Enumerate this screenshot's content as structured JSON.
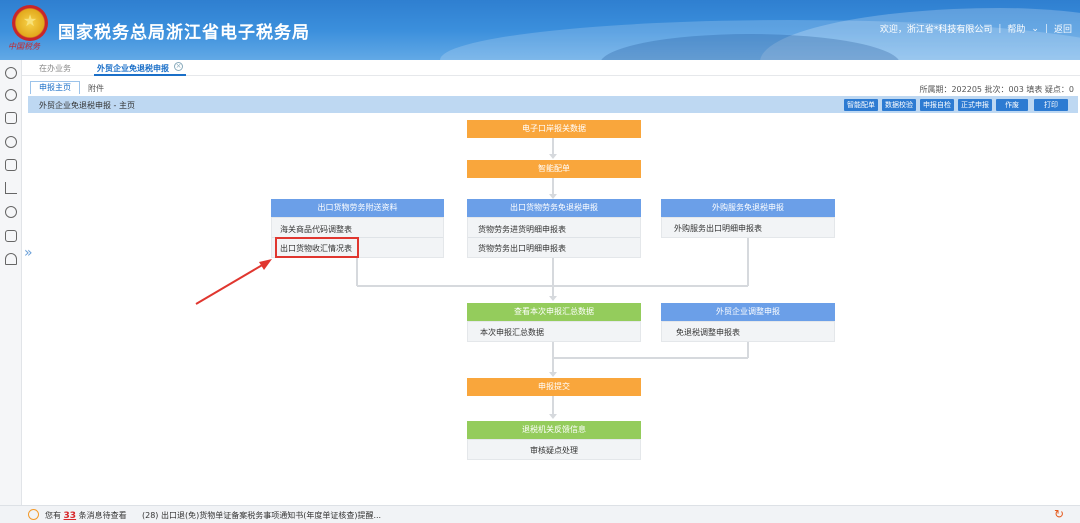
{
  "header": {
    "site_title": "国家税务总局浙江省电子税务局",
    "emblem_sig": "中国税务",
    "welcome": "欢迎，浙江省*科技有限公司",
    "help": "帮助",
    "back": "返回"
  },
  "tabs": {
    "inprogress": "在办业务",
    "export": "外贸企业免退税申报"
  },
  "subtabs": {
    "main": "申报主页",
    "attach": "附件",
    "period_info": "所属期：202205  批次：003  填表  疑点：0"
  },
  "page_bar": {
    "title": "外贸企业免退税申报 - 主页",
    "buttons": [
      "智能配单",
      "数据校验",
      "申报自检",
      "正式申报",
      "作废",
      "打印"
    ]
  },
  "flow": {
    "step_customs": "电子口岸报关数据",
    "step_match": "智能配单",
    "export_attach": {
      "title": "出口货物劳务附送资料",
      "items": [
        "海关商品代码调整表",
        "出口货物收汇情况表"
      ]
    },
    "export_refund": {
      "title": "出口货物劳务免退税申报",
      "items": [
        "货物劳务进货明细申报表",
        "货物劳务出口明细申报表"
      ]
    },
    "service_refund": {
      "title": "外购服务免退税申报",
      "items": [
        "外购服务出口明细申报表"
      ]
    },
    "summary": {
      "title": "查看本次申报汇总数据",
      "items": [
        "本次申报汇总数据"
      ]
    },
    "adjust": {
      "title": "外贸企业调整申报",
      "items": [
        "免退税调整申报表"
      ]
    },
    "submit": "申报提交",
    "feedback": {
      "title": "退税机关反馈信息",
      "items": [
        "审核疑点处理"
      ]
    }
  },
  "footer": {
    "prefix": "您有",
    "count": "33",
    "suffix": "条消息待查看",
    "news": "(28)  出口退(免)货物单证备案税务事项通知书(年度单证核查)提醒..."
  },
  "colors": {
    "orange": "#f9a63c",
    "green": "#94cc5c",
    "blue": "#6b9fe8",
    "highlight": "#e0362f"
  }
}
